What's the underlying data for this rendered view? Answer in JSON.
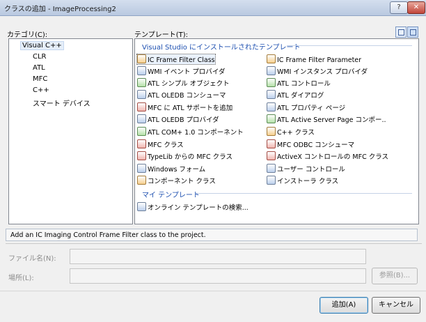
{
  "window": {
    "title": "クラスの追加 - ImageProcessing2",
    "help_glyph": "?",
    "close_glyph": "✕"
  },
  "categories": {
    "label": "カテゴリ(C):",
    "items": [
      {
        "label": "Visual C++"
      },
      {
        "label": "CLR"
      },
      {
        "label": "ATL"
      },
      {
        "label": "MFC"
      },
      {
        "label": "C++"
      },
      {
        "label": "スマート デバイス"
      }
    ]
  },
  "templates": {
    "label": "テンプレート(T):",
    "installed_header": "Visual Studio にインストールされたテンプレート",
    "left_column": [
      {
        "label": "IC Frame Filter Class",
        "icon": "ic-frame-filter-icon"
      },
      {
        "label": "WMI イベント プロバイダ",
        "icon": "wmi-event-icon"
      },
      {
        "label": "ATL シンプル オブジェクト",
        "icon": "atl-simple-object-icon"
      },
      {
        "label": "ATL OLEDB コンシューマ",
        "icon": "atl-oledb-consumer-icon"
      },
      {
        "label": "MFC に ATL サポートを追加",
        "icon": "mfc-atl-support-icon"
      },
      {
        "label": "ATL OLEDB プロバイダ",
        "icon": "atl-oledb-provider-icon"
      },
      {
        "label": "ATL COM+ 1.0 コンポーネント",
        "icon": "atl-complus-icon"
      },
      {
        "label": "MFC クラス",
        "icon": "mfc-class-icon"
      },
      {
        "label": "TypeLib からの MFC クラス",
        "icon": "typelib-mfc-icon"
      },
      {
        "label": "Windows フォーム",
        "icon": "windows-form-icon"
      },
      {
        "label": "コンポーネント クラス",
        "icon": "component-class-icon"
      }
    ],
    "right_column": [
      {
        "label": "IC Frame Filter Parameter",
        "icon": "ic-frame-param-icon"
      },
      {
        "label": "WMI インスタンス プロバイダ",
        "icon": "wmi-instance-icon"
      },
      {
        "label": "ATL コントロール",
        "icon": "atl-control-icon"
      },
      {
        "label": "ATL ダイアログ",
        "icon": "atl-dialog-icon"
      },
      {
        "label": "ATL プロパティ ページ",
        "icon": "atl-property-page-icon"
      },
      {
        "label": "ATL Active Server Page コンポー..",
        "icon": "atl-asp-icon"
      },
      {
        "label": "C++ クラス",
        "icon": "cpp-class-icon"
      },
      {
        "label": "MFC ODBC コンシューマ",
        "icon": "mfc-odbc-icon"
      },
      {
        "label": "ActiveX コントロールの MFC クラス",
        "icon": "activex-mfc-icon"
      },
      {
        "label": "ユーザー コントロール",
        "icon": "user-control-icon"
      },
      {
        "label": "インストーラ クラス",
        "icon": "installer-class-icon"
      }
    ],
    "my_header": "マイ テンプレート",
    "my_items": [
      {
        "label": "オンライン テンプレートの検索...",
        "icon": "online-search-icon"
      }
    ]
  },
  "description": "Add an IC Imaging Control Frame Filter class to the project.",
  "form": {
    "filename_label": "ファイル名(N):",
    "filename_value": "",
    "location_label": "場所(L):",
    "location_value": "",
    "browse_label": "参照(B)..."
  },
  "buttons": {
    "add": "追加(A)",
    "cancel": "キャンセル"
  }
}
